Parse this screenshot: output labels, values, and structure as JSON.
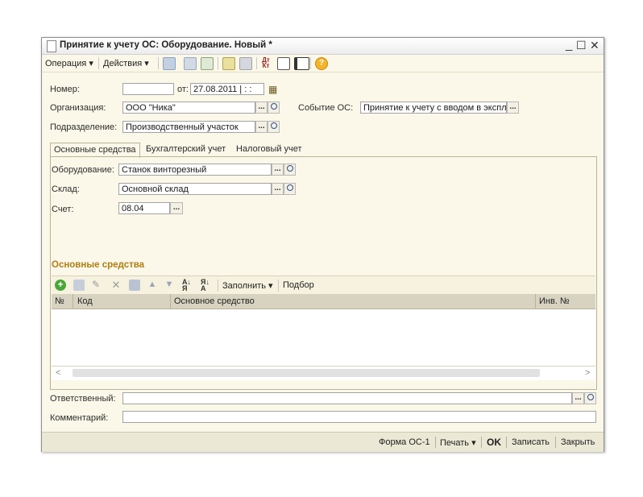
{
  "window": {
    "title": "Принятие к учету ОС: Оборудование. Новый *",
    "minimize_glyph": "_",
    "maximize_glyph": "☐",
    "close_glyph": "✕"
  },
  "menu": {
    "operation": "Операция ▾",
    "actions": "Действия ▾"
  },
  "toolbar_icons": [
    "add-icon",
    "refresh-icon",
    "copy-icon",
    "print-preview-icon",
    "post-icon",
    "unpost-icon",
    "ledger-icon",
    "report-icon",
    "structure-icon",
    "help-icon"
  ],
  "form": {
    "number_label": "Номер:",
    "number_value": "",
    "date_label": "от:",
    "date_value": "27.08.2011 | :  :",
    "org_label": "Организация:",
    "org_value": "ООО \"Ника\"",
    "event_label": "Событие ОС:",
    "event_value": "Принятие к учету с вводом в экспл",
    "division_label": "Подразделение:",
    "division_value": "Производственный участок"
  },
  "tabs": [
    "Основные средства",
    "Бухгалтерский учет",
    "Налоговый учет"
  ],
  "tab_main": {
    "equipment_label": "Оборудование:",
    "equipment_value": "Станок винторезный",
    "warehouse_label": "Склад:",
    "warehouse_value": "Основной склад",
    "account_label": "Счет:",
    "account_value": "08.04"
  },
  "assets": {
    "title": "Основные средства",
    "fill_label": "Заполнить ▾",
    "pick_label": "Подбор",
    "columns": [
      "№",
      "Код",
      "Основное средство",
      "Инв. №"
    ],
    "rows": []
  },
  "footer_fields": {
    "responsible_label": "Ответственный:",
    "responsible_value": "",
    "comment_label": "Комментарий:",
    "comment_value": ""
  },
  "buttons": {
    "form_os1": "Форма ОС-1",
    "print": "Печать ▾",
    "ok": "OK",
    "save": "Записать",
    "close": "Закрыть"
  },
  "common": {
    "ellipsis": "...",
    "scroll_left": "<",
    "scroll_right": ">",
    "calendar": "▦"
  }
}
